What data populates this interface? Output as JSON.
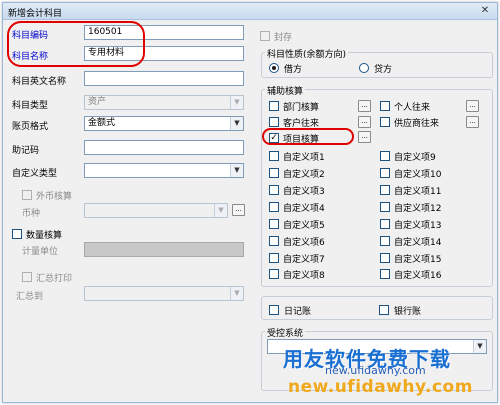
{
  "window": {
    "title": "新增会计科目",
    "close_symbol": "✕"
  },
  "form": {
    "code": {
      "label": "科目编码",
      "value": "160501"
    },
    "name": {
      "label": "科目名称",
      "value": "专用材料"
    },
    "english_name": {
      "label": "科目英文名称",
      "value": ""
    },
    "type": {
      "label": "科目类型",
      "value": "资产"
    },
    "book_format": {
      "label": "账页格式",
      "value": "金额式"
    },
    "mnemonic": {
      "label": "助记码",
      "value": ""
    },
    "custom_type": {
      "label": "自定义类型",
      "value": ""
    },
    "foreign_currency": {
      "label": "外币核算",
      "checked": false
    },
    "currency": {
      "label": "币种",
      "value": ""
    },
    "quantity": {
      "label": "数量核算",
      "checked": false
    },
    "unit": {
      "label": "计量单位",
      "value": ""
    },
    "summary_print": {
      "label": "汇总打印",
      "checked": false
    },
    "summary_to": {
      "label": "汇总到",
      "value": ""
    }
  },
  "seal": {
    "label": "封存",
    "checked": false
  },
  "nature": {
    "title": "科目性质(余额方向)",
    "options": [
      {
        "label": "借方",
        "selected": true
      },
      {
        "label": "贷方",
        "selected": false
      }
    ]
  },
  "aux": {
    "title": "辅助核算",
    "dots": "...",
    "left": [
      {
        "label": "部门核算",
        "checked": false
      },
      {
        "label": "客户往来",
        "checked": false
      },
      {
        "label": "项目核算",
        "checked": true
      },
      {
        "label": "自定义项1",
        "checked": false
      },
      {
        "label": "自定义项2",
        "checked": false
      },
      {
        "label": "自定义项3",
        "checked": false
      },
      {
        "label": "自定义项4",
        "checked": false
      },
      {
        "label": "自定义项5",
        "checked": false
      },
      {
        "label": "自定义项6",
        "checked": false
      },
      {
        "label": "自定义项7",
        "checked": false
      },
      {
        "label": "自定义项8",
        "checked": false
      }
    ],
    "right": [
      {
        "label": "个人往来",
        "checked": false
      },
      {
        "label": "供应商往来",
        "checked": false
      },
      {
        "label": "自定义项9",
        "checked": false
      },
      {
        "label": "自定义项10",
        "checked": false
      },
      {
        "label": "自定义项11",
        "checked": false
      },
      {
        "label": "自定义项12",
        "checked": false
      },
      {
        "label": "自定义项13",
        "checked": false
      },
      {
        "label": "自定义项14",
        "checked": false
      },
      {
        "label": "自定义项15",
        "checked": false
      },
      {
        "label": "自定义项16",
        "checked": false
      }
    ]
  },
  "journal": {
    "label": "日记账",
    "checked": false
  },
  "bank": {
    "label": "银行账",
    "checked": false
  },
  "controlled_system": {
    "title": "受控系统",
    "value": ""
  },
  "watermark": {
    "line1": "用友软件免费下载",
    "line2": "new.ufidawhy.com",
    "line3": "new.ufidawhy.com"
  },
  "symbols": {
    "check": "✓",
    "combo": "▼"
  },
  "colors": {
    "annotation": "#e00000",
    "label_blue": "#0000cc",
    "watermark_blue": "#1a6fd2",
    "watermark_orange": "#f0a81c"
  }
}
